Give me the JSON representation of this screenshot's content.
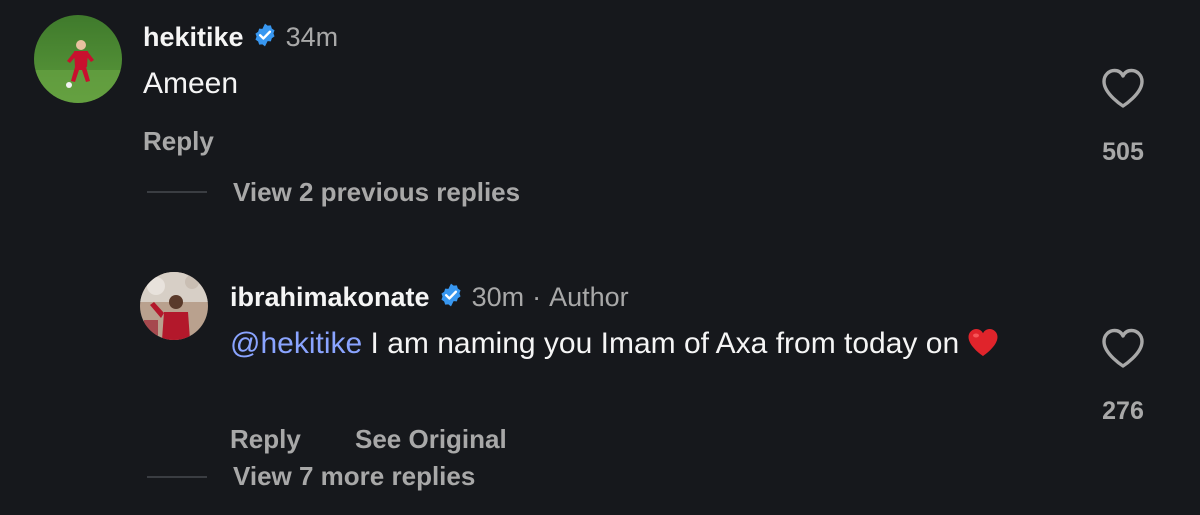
{
  "comment1": {
    "username": "hekitike",
    "time": "34m",
    "text": "Ameen",
    "reply_label": "Reply",
    "likes": "505",
    "view_previous": "View 2 previous replies"
  },
  "reply1": {
    "username": "ibrahimakonate",
    "time": "30m",
    "separator": "·",
    "author_label": "Author",
    "mention": "@hekitike",
    "text": " I am naming you Imam of Axa from today on ",
    "emoji": "❤️",
    "reply_label": "Reply",
    "see_original_label": "See Original",
    "likes": "276",
    "view_more": "View 7 more replies"
  },
  "colors": {
    "background": "#16181c",
    "verified": "#3897f0",
    "mention": "#8aa4ff",
    "muted": "#a8a8a8"
  },
  "icons": {
    "verified": "verified-badge-icon",
    "like": "heart-outline-icon"
  }
}
